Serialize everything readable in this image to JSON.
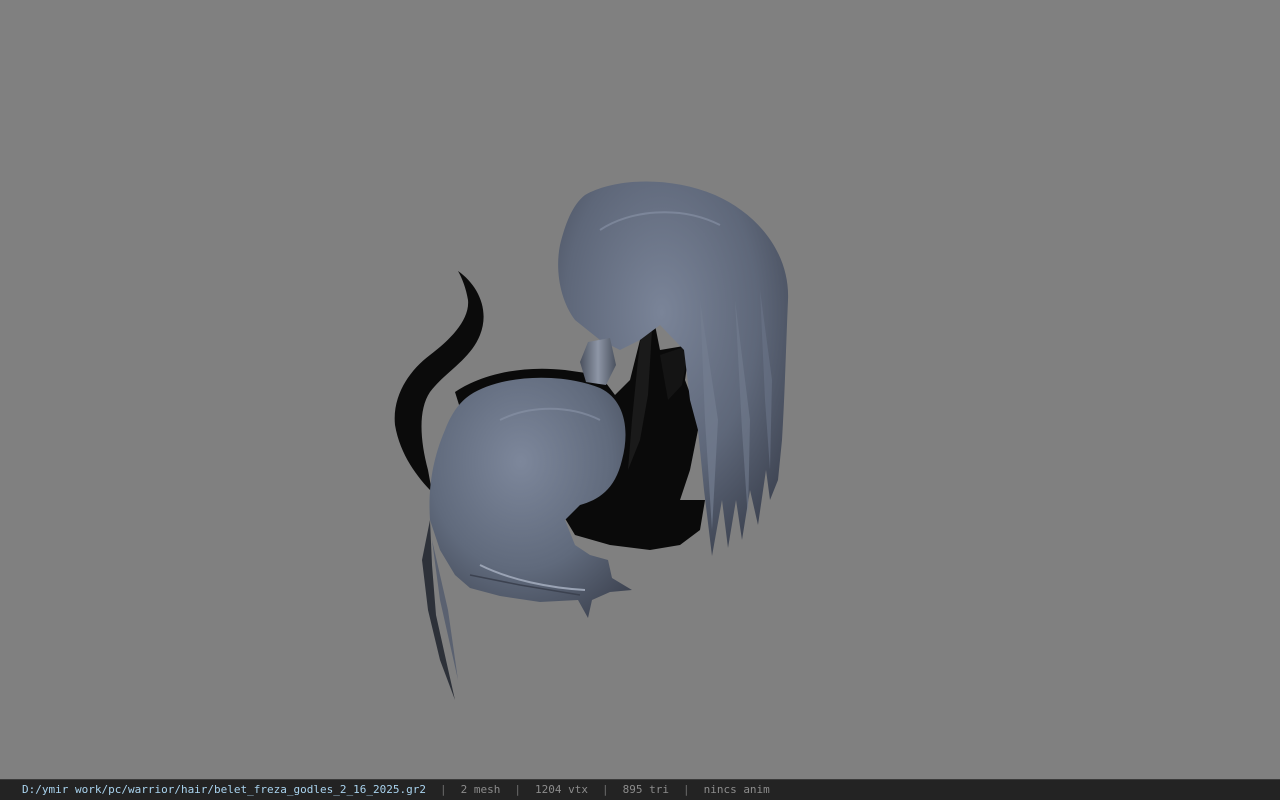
{
  "viewer": {
    "background_color": "#808080",
    "model": {
      "description_icon": "hair-model",
      "hair_color": "#5d6679",
      "horn_color": "#0b0b0b"
    }
  },
  "statusbar": {
    "file_path": "D:/ymir work/pc/warrior/hair/belet_freza_godles_2_16_2025.gr2",
    "mesh_count": "2 mesh",
    "vertex_count": "1204 vtx",
    "triangle_count": "895 tri",
    "anim_status": "nincs anim",
    "separator": "|"
  }
}
